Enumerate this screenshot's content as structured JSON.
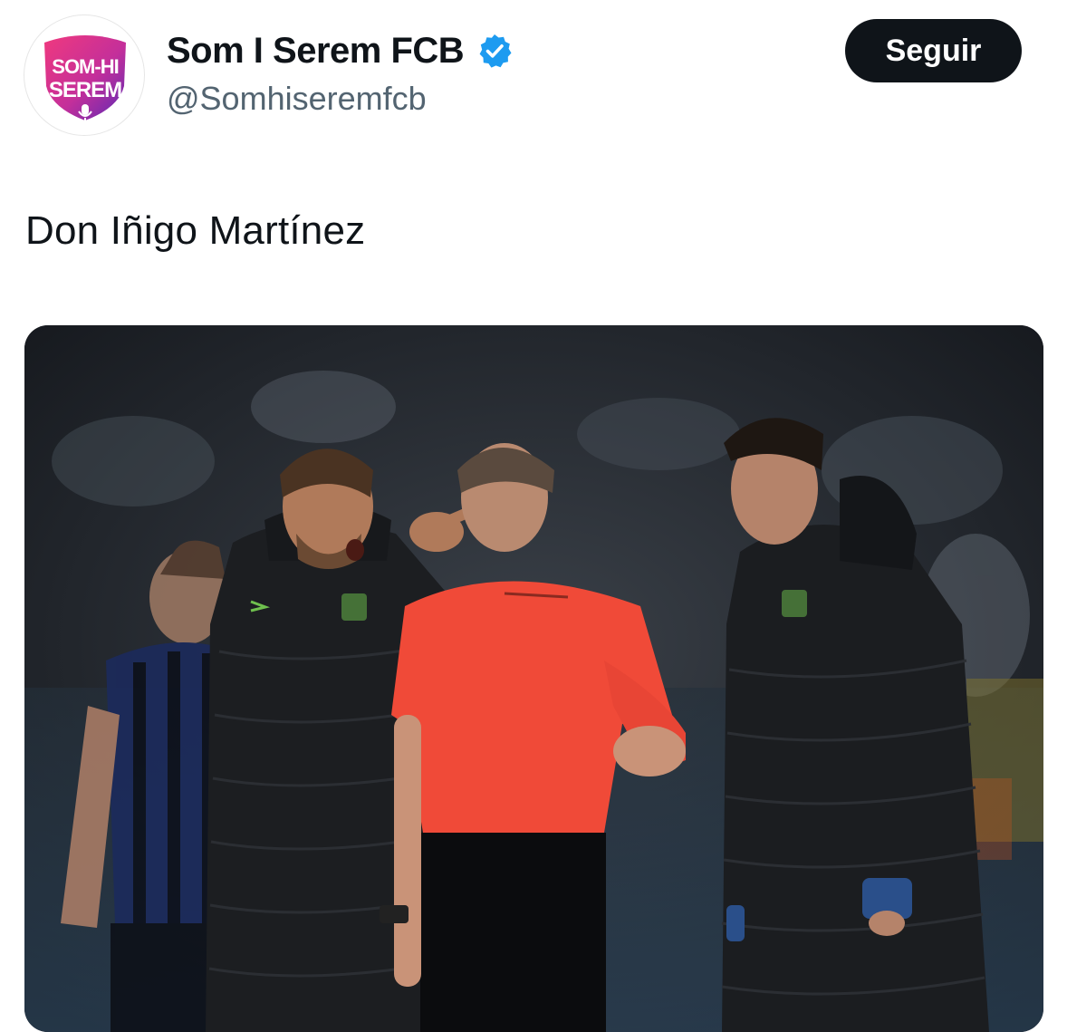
{
  "account": {
    "display_name": "Som I Serem FCB",
    "handle": "@Somhiseremfcb",
    "avatar_text_line1": "SOM-HI",
    "avatar_text_line2": "SEREM",
    "verified": true
  },
  "follow_button": {
    "label": "Seguir"
  },
  "tweet": {
    "text": "Don Iñigo Martínez"
  },
  "media": {
    "type": "photo"
  },
  "colors": {
    "text_primary": "#0f1419",
    "text_secondary": "#536471",
    "verified_blue": "#1d9bf0",
    "button_bg": "#0f1419",
    "avatar_pink": "#e8347a",
    "avatar_purple": "#5b2ab5"
  },
  "icons": [
    "verified-badge-icon",
    "microphone-icon"
  ]
}
